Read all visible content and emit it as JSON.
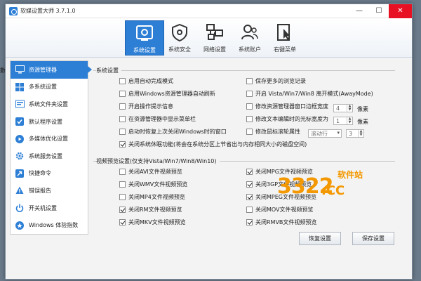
{
  "window": {
    "title": "软媒设置大师 3.7.1.0",
    "controls": [
      "—",
      "☐",
      "✕"
    ]
  },
  "toolbar": {
    "items": [
      {
        "label": "系统设置",
        "icon": "system-settings-icon",
        "active": true
      },
      {
        "label": "系统安全",
        "icon": "shield-icon",
        "active": false
      },
      {
        "label": "网络设置",
        "icon": "network-icon",
        "active": false
      },
      {
        "label": "系统账户",
        "icon": "users-icon",
        "active": false
      },
      {
        "label": "右键菜单",
        "icon": "cursor-icon",
        "active": false
      }
    ]
  },
  "sidebar": {
    "items": [
      {
        "label": "资源管理器",
        "icon": "monitor-icon",
        "active": true
      },
      {
        "label": "多系统设置",
        "icon": "windows-icon",
        "active": false
      },
      {
        "label": "系统文件夹设置",
        "icon": "folder-icon",
        "active": false
      },
      {
        "label": "默认程序设置",
        "icon": "checkbox-icon",
        "active": false
      },
      {
        "label": "多媒体优化设置",
        "icon": "media-icon",
        "active": false
      },
      {
        "label": "系统服务设置",
        "icon": "gear-icon",
        "active": false
      },
      {
        "label": "快捷命令",
        "icon": "arrow-icon",
        "active": false
      },
      {
        "label": "错误报告",
        "icon": "warning-icon",
        "active": false
      },
      {
        "label": "开关机设置",
        "icon": "power-icon",
        "active": false
      },
      {
        "label": "Windows 体验指数",
        "icon": "star-icon",
        "active": false
      }
    ]
  },
  "system_settings": {
    "title": "系统设置",
    "left_options": [
      {
        "label": "启用自动完成模式",
        "checked": false
      },
      {
        "label": "启用Windows资源管理器自动刷新",
        "checked": false
      },
      {
        "label": "开启操作提示信息",
        "checked": false
      },
      {
        "label": "在资源管理器中显示菜单栏",
        "checked": false
      },
      {
        "label": "启动时恢复上次关闭Windows时的窗口",
        "checked": false
      }
    ],
    "right_options": [
      {
        "label": "保存更多的浏览记录",
        "checked": false
      },
      {
        "label": "开启 Vista/Win7/Win8 离开模式(AwayMode)",
        "checked": false
      },
      {
        "label": "修改资源管理器窗口边框宽度",
        "checked": false
      },
      {
        "label": "修改文本编辑时的光标宽度为",
        "checked": false
      },
      {
        "label": "修改鼠标滚轮属性",
        "checked": false
      }
    ],
    "border_width": {
      "value": "4",
      "unit": "像素"
    },
    "cursor_width": {
      "value": "1",
      "unit": "像素"
    },
    "scroll_select": "滚动行",
    "scroll_value": "3",
    "hibernate": {
      "label": "关闭系统休眠功能(将会在系统分区上节省出与内存相同大小的磁盘空间)",
      "checked": true
    }
  },
  "video_preview": {
    "title": "视频预览设置(仅支持Vista/Win7/Win8/Win10)",
    "left_options": [
      {
        "label": "关闭AVI文件视频预览",
        "checked": false
      },
      {
        "label": "关闭WMV文件视频预览",
        "checked": false
      },
      {
        "label": "关闭MP4文件视频预览",
        "checked": false
      },
      {
        "label": "关闭RM文件视频预览",
        "checked": true
      },
      {
        "label": "关闭MKV文件视频预览",
        "checked": true
      }
    ],
    "right_options": [
      {
        "label": "关闭MPG文件视频预览",
        "checked": true
      },
      {
        "label": "关闭3GP文件视频预览",
        "checked": true
      },
      {
        "label": "关闭MPEG文件视频预览",
        "checked": true
      },
      {
        "label": "关闭MOV文件视频预览",
        "checked": false
      },
      {
        "label": "关闭RMVB文件视频预览",
        "checked": true
      }
    ]
  },
  "buttons": {
    "restore": "恢复设置",
    "save": "保存设置"
  },
  "watermark": {
    "number": "3322",
    "cc": ".CC",
    "site": "软件站"
  }
}
